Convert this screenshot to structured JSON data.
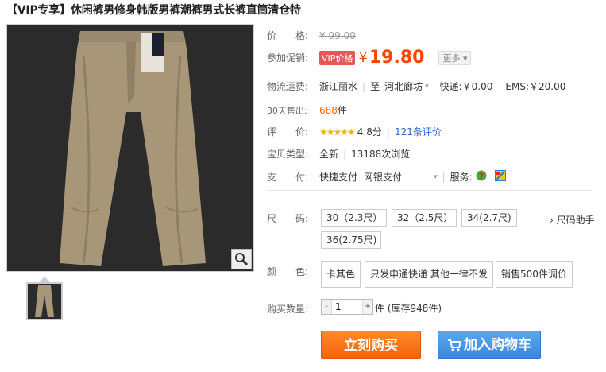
{
  "product": {
    "title": "【VIP专享】休闲裤男修身韩版男裤潮裤男式长裤直筒清仓特"
  },
  "price": {
    "label": "价　　格:",
    "original": "¥ 99.00"
  },
  "promo": {
    "label": "参加促销:",
    "tag": "VIP价格",
    "currency": "¥",
    "value": "19.80",
    "more": "更多 ▾"
  },
  "shipping": {
    "label": "物流运费:",
    "from": "浙江丽水",
    "to_prefix": "至",
    "to": "河北廊坊",
    "dropdown": "▾",
    "express": "快递:￥0.00",
    "ems": "EMS:￥20.00"
  },
  "sales": {
    "label": "30天售出:",
    "count": "688",
    "unit": "件"
  },
  "rating": {
    "label": "评　　价:",
    "stars": "★★★★★",
    "score": "4.8分",
    "reviews": "121条评价"
  },
  "type": {
    "label": "宝贝类型:",
    "condition": "全新",
    "views": "13188次浏览"
  },
  "payment": {
    "label": "支　　付:",
    "method1": "快捷支付",
    "method2": "网银支付",
    "dropdown": "▾",
    "service_label": "服务:"
  },
  "size": {
    "label": "尺　　码:",
    "options": [
      "30（2.3尺）",
      "32（2.5尺）",
      "34(2.7尺)",
      "36(2.75尺)"
    ],
    "helper": "› 尺码助手"
  },
  "color": {
    "label": "颜　　色:",
    "options": [
      "卡其色",
      "只发申通快递 其他一律不发",
      "销售500件调价"
    ]
  },
  "quantity": {
    "label": "购买数量:",
    "value": "1",
    "minus": "-",
    "plus": "+",
    "stock": "件 (库存948件)"
  },
  "actions": {
    "buy": "立刻购买",
    "cart": "加入购物车"
  },
  "colors": {
    "price_accent": "#ff4400",
    "buy_button": "#f2620b",
    "cart_button": "#3b86d9",
    "vip_tag": "#e4585a"
  }
}
